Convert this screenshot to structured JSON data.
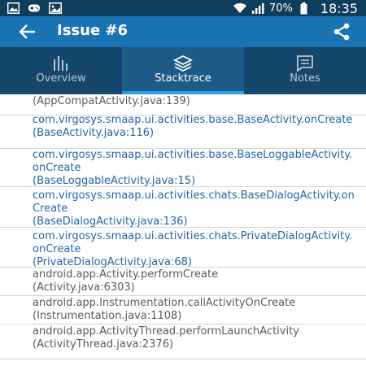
{
  "status_bar": {
    "battery": "70%",
    "time": "18:35"
  },
  "app_bar": {
    "title": "Issue #6",
    "icons": [
      "back-arrow-icon",
      "share-icon"
    ]
  },
  "tabs": [
    {
      "label": "Overview",
      "icon": "bar-chart-icon",
      "active": false
    },
    {
      "label": "Stacktrace",
      "icon": "layers-icon",
      "active": true
    },
    {
      "label": "Notes",
      "icon": "notes-icon",
      "active": false
    }
  ],
  "colors": {
    "status_bar": "#113d5c",
    "app_bar": "#1a74b4",
    "tab_bar": "#14476b",
    "tab_active": "#1d5a86",
    "tab_indicator": "#2aa0e8",
    "app_frame": "#1f66a8",
    "system_frame": "#5a5a5a"
  },
  "stacktrace": [
    {
      "method": "",
      "location": "(AppCompatActivity.java:139)",
      "app_frame": false
    },
    {
      "method": "com.virgosys.smaap.ui.activities.base.BaseActivity.onCreate",
      "location": "(BaseActivity.java:116)",
      "app_frame": true
    },
    {
      "method": "com.virgosys.smaap.ui.activities.base.BaseLoggableActivity.onCreate",
      "location": "(BaseLoggableActivity.java:15)",
      "app_frame": true
    },
    {
      "method": "com.virgosys.smaap.ui.activities.chats.BaseDialogActivity.onCreate",
      "location": "(BaseDialogActivity.java:136)",
      "app_frame": true
    },
    {
      "method": "com.virgosys.smaap.ui.activities.chats.PrivateDialogActivity.onCreate",
      "location": "(PrivateDialogActivity.java:68)",
      "app_frame": true
    },
    {
      "method": "android.app.Activity.performCreate",
      "location": "(Activity.java:6303)",
      "app_frame": false
    },
    {
      "method": "android.app.Instrumentation.callActivityOnCreate",
      "location": "(Instrumentation.java:1108)",
      "app_frame": false
    },
    {
      "method": "android.app.ActivityThread.performLaunchActivity",
      "location": "(ActivityThread.java:2376)",
      "app_frame": false
    }
  ]
}
